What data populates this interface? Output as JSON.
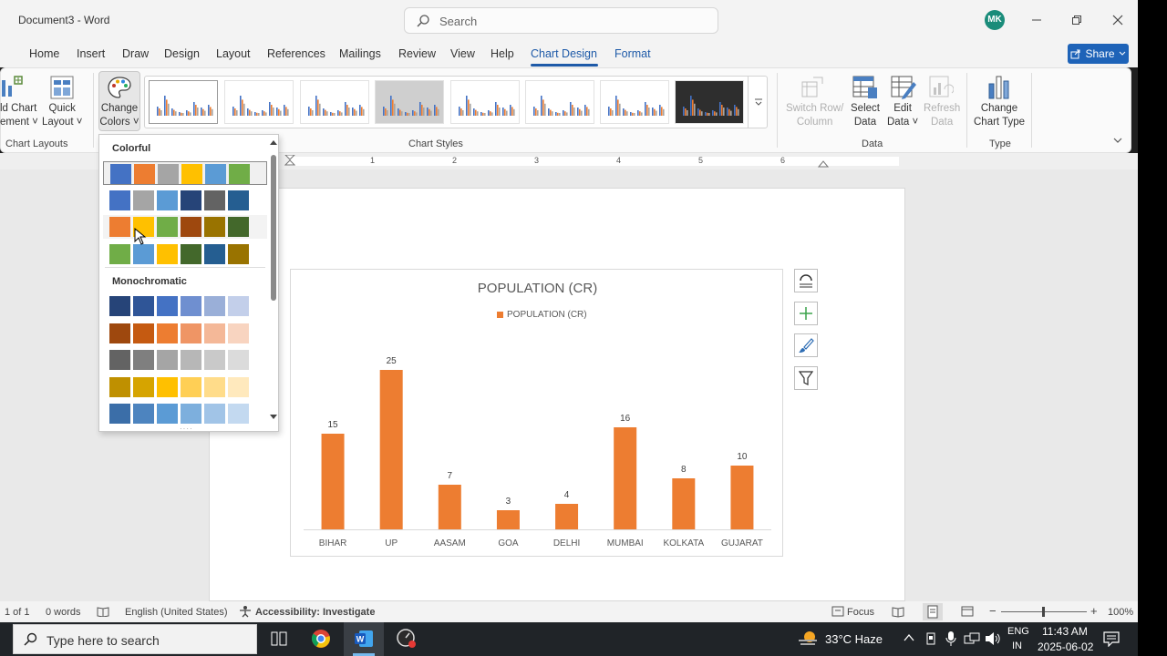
{
  "window": {
    "title": "Document3  -  Word",
    "avatar_initials": "MK"
  },
  "search": {
    "placeholder": "Search"
  },
  "menu": {
    "tabs": [
      "Home",
      "Insert",
      "Draw",
      "Design",
      "Layout",
      "References",
      "Mailings",
      "Review",
      "View",
      "Help",
      "Chart Design",
      "Format"
    ],
    "active": "Chart Design",
    "share_label": "Share"
  },
  "ribbon": {
    "add_chart_element": [
      "ld Chart",
      "ement"
    ],
    "quick_layout": [
      "Quick",
      "Layout"
    ],
    "change_colors": [
      "Change",
      "Colors"
    ],
    "chart_layouts_group": "Chart Layouts",
    "chart_styles_group": "Chart Styles",
    "switch_row_column": [
      "Switch Row/",
      "Column"
    ],
    "select_data": [
      "Select",
      "Data"
    ],
    "edit_data": [
      "Edit",
      "Data"
    ],
    "refresh_data": [
      "Refresh",
      "Data"
    ],
    "data_group": "Data",
    "change_chart_type": [
      "Change",
      "Chart Type"
    ],
    "type_group": "Type"
  },
  "ruler": {
    "numbers": [
      "1",
      "2",
      "3",
      "4",
      "5",
      "6"
    ]
  },
  "colors_dropdown": {
    "colorful_heading": "Colorful",
    "monochromatic_heading": "Monochromatic",
    "colorful_rows": [
      [
        "#4472c4",
        "#ed7d31",
        "#a5a5a5",
        "#ffc000",
        "#5b9bd5",
        "#70ad47"
      ],
      [
        "#4472c4",
        "#a5a5a5",
        "#5b9bd5",
        "#264478",
        "#636363",
        "#255e91"
      ],
      [
        "#ed7d31",
        "#ffc000",
        "#70ad47",
        "#9e480e",
        "#997300",
        "#43682b"
      ],
      [
        "#70ad47",
        "#5b9bd5",
        "#ffc000",
        "#43682b",
        "#255e91",
        "#997300"
      ]
    ],
    "mono_rows": [
      [
        "#264478",
        "#2f5597",
        "#4472c4",
        "#6f8fd0",
        "#9aafd8",
        "#c3cfea"
      ],
      [
        "#9e480e",
        "#c55a11",
        "#ed7d31",
        "#ef9565",
        "#f4b898",
        "#f8d4c0"
      ],
      [
        "#636363",
        "#7f7f7f",
        "#a5a5a5",
        "#b7b7b7",
        "#c9c9c9",
        "#dbdbdb"
      ],
      [
        "#bf9000",
        "#d6a400",
        "#ffc000",
        "#ffcf55",
        "#ffdc8a",
        "#ffe9bd"
      ],
      [
        "#3b6ea8",
        "#4d84bf",
        "#5b9bd5",
        "#7dafdd",
        "#a1c4e7",
        "#c3d9f0"
      ]
    ]
  },
  "chart_data": {
    "type": "bar",
    "title": "POPULATION (CR)",
    "categories": [
      "BIHAR",
      "UP",
      "AASAM",
      "GOA",
      "DELHI",
      "MUMBAI",
      "KOLKATA",
      "GUJARAT"
    ],
    "series": [
      {
        "name": "POPULATION (CR)",
        "values": [
          15,
          25,
          7,
          3,
          4,
          16,
          8,
          10
        ],
        "color": "#ed7d31"
      }
    ],
    "legend": "top",
    "grid": false,
    "ylim": [
      0,
      25
    ]
  },
  "status": {
    "page": "1 of 1",
    "words": "0 words",
    "language": "English (United States)",
    "accessibility": "Accessibility: Investigate",
    "focus": "Focus",
    "zoom": "100%"
  },
  "taskbar": {
    "search_placeholder": "Type here to search",
    "weather": "33°C  Haze",
    "lang_top": "ENG",
    "lang_bottom": "IN",
    "time": "11:43 AM",
    "date": "2025-06-02"
  },
  "colors": {
    "accent": "#1e5aa8",
    "bar": "#ed7d31"
  }
}
